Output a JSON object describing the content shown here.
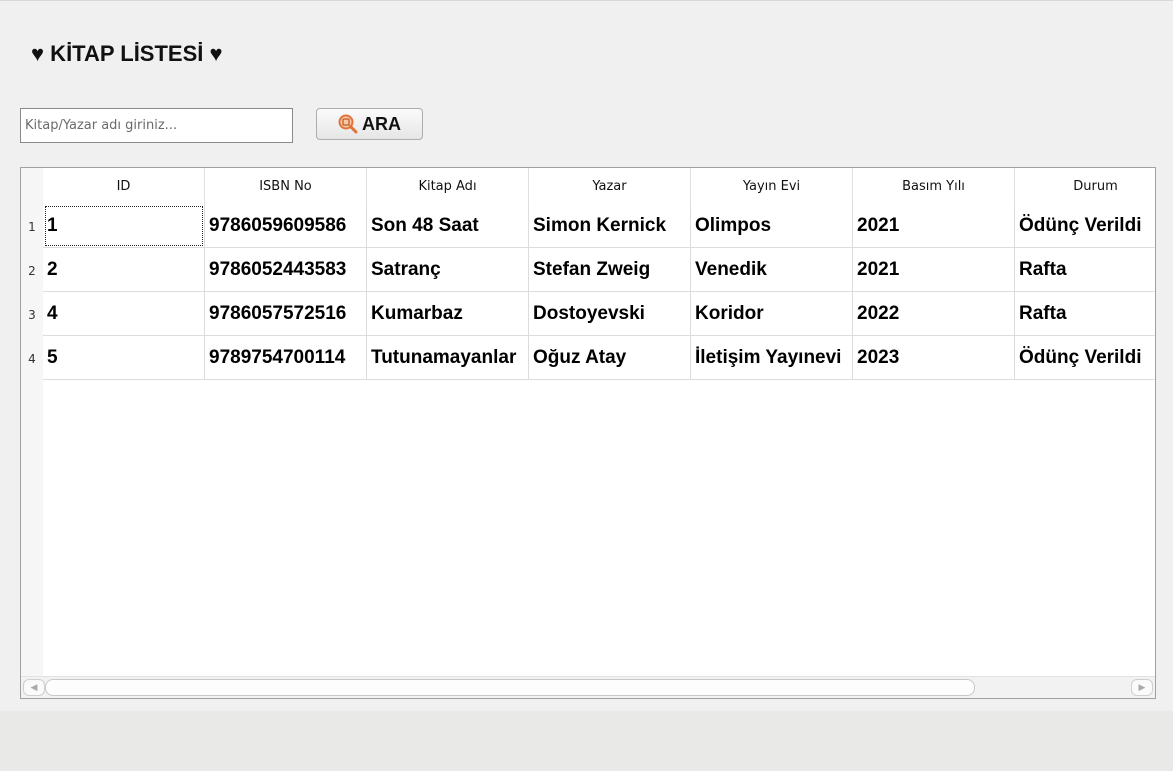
{
  "app": {
    "title": "♥ KİTAP LİSTESİ ♥"
  },
  "search": {
    "placeholder": "Kitap/Yazar adı giriniz...",
    "value": "",
    "button_label": "ARA",
    "button_icon": "search-icon"
  },
  "table": {
    "columns": [
      "ID",
      "ISBN No",
      "Kitap Adı",
      "Yazar",
      "Yayın Evi",
      "Basım Yılı",
      "Durum"
    ],
    "row_numbers": [
      "1",
      "2",
      "3",
      "4"
    ],
    "rows": [
      [
        "1",
        "9786059609586",
        "Son 48 Saat",
        "Simon Kernick",
        "Olimpos",
        "2021",
        "Ödünç Verildi"
      ],
      [
        "2",
        "9786052443583",
        "Satranç",
        "Stefan Zweig",
        "Venedik",
        "2021",
        "Rafta"
      ],
      [
        "4",
        "9786057572516",
        "Kumarbaz",
        "Dostoyevski",
        "Koridor",
        "2022",
        "Rafta"
      ],
      [
        "5",
        "9789754700114",
        "Tutunamayanlar",
        "Oğuz Atay",
        "İletişim Yayınevi",
        "2023",
        "Ödünç Verildi"
      ]
    ]
  },
  "colors": {
    "window_bg": "#f0f0f0",
    "table_bg": "#ffffff",
    "grid_line": "#dcdcdc",
    "icon_accent": "#e0733a"
  }
}
